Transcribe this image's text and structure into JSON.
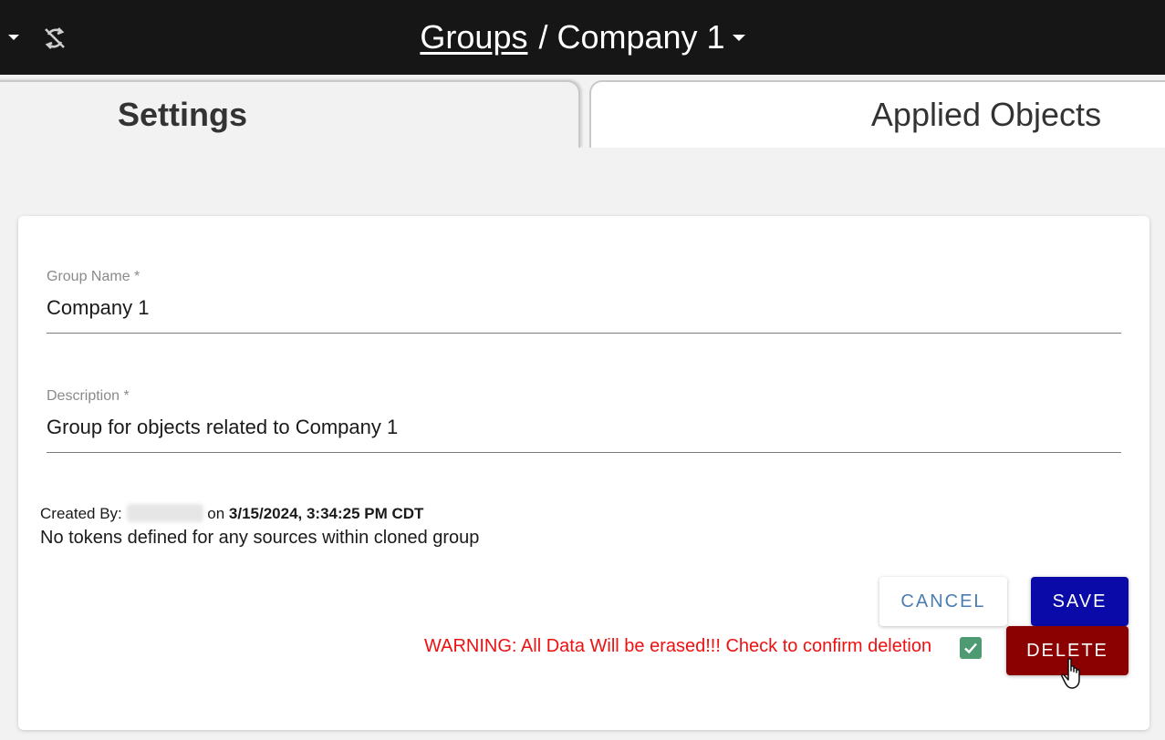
{
  "header": {
    "breadcrumb_link": "Groups",
    "separator": "/",
    "current_group": "Company 1",
    "icons": [
      "caret-down-icon",
      "sync-disabled-icon",
      "chevron-down-icon"
    ]
  },
  "tabs": [
    {
      "label": "Settings",
      "active": true
    },
    {
      "label": "Applied Objects",
      "active": false
    }
  ],
  "form": {
    "group_name_label": "Group Name *",
    "group_name_value": "Company 1",
    "description_label": "Description *",
    "description_value": "Group for objects related to Company 1"
  },
  "meta": {
    "created_by_label": "Created By:",
    "on_label": "on",
    "created_at": "3/15/2024, 3:34:25 PM CDT",
    "note": "No tokens defined for any sources within cloned group"
  },
  "actions": {
    "cancel_label": "CANCEL",
    "save_label": "SAVE",
    "delete_label": "DELETE",
    "warning_text": "WARNING: All Data Will be erased!!! Check to confirm deletion",
    "confirm_checked": true
  },
  "colors": {
    "topbar": "#161616",
    "save": "#0a0aa8",
    "delete": "#8b0000",
    "warning": "#ee1111",
    "checkbox": "#4e9a72",
    "cancel_text": "#4a7db0"
  }
}
